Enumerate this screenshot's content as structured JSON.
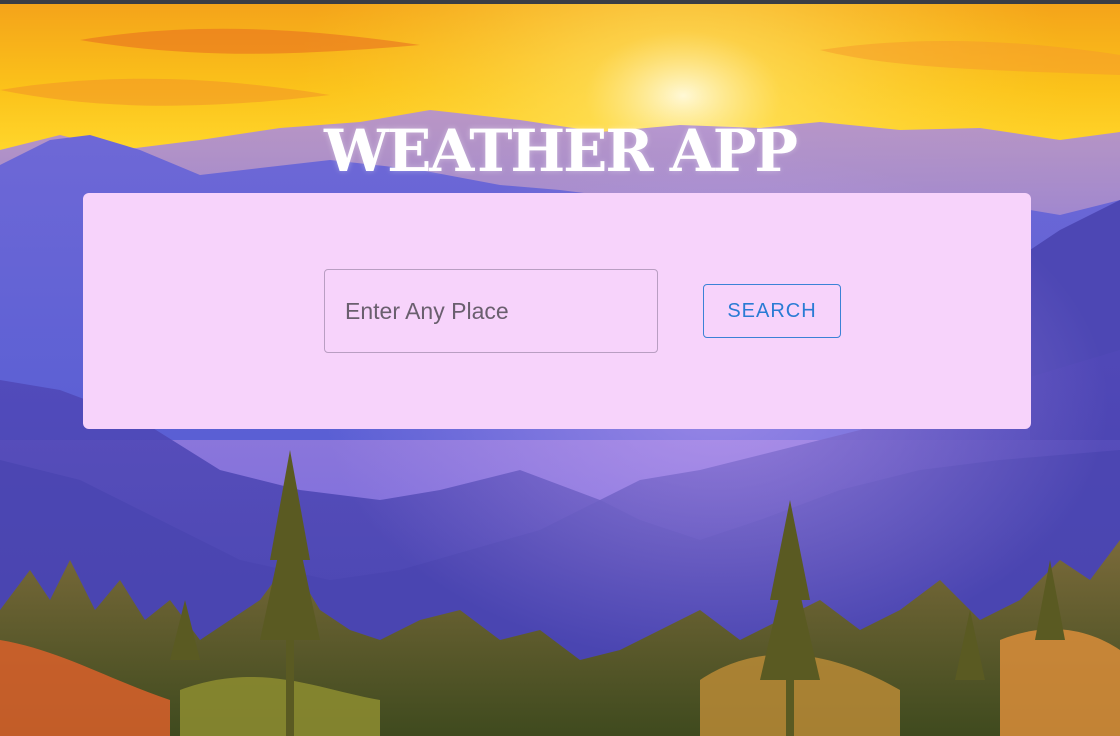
{
  "app": {
    "title": "WEATHER APP"
  },
  "search": {
    "placeholder": "Enter Any Place",
    "value": "",
    "button_label": "SEARCH"
  },
  "colors": {
    "card_background": "#f7d3fb",
    "button_accent": "#2a7bd4",
    "title_text": "#ffffff"
  },
  "background": {
    "subject": "sunset over purple mountain ranges with pine trees"
  }
}
